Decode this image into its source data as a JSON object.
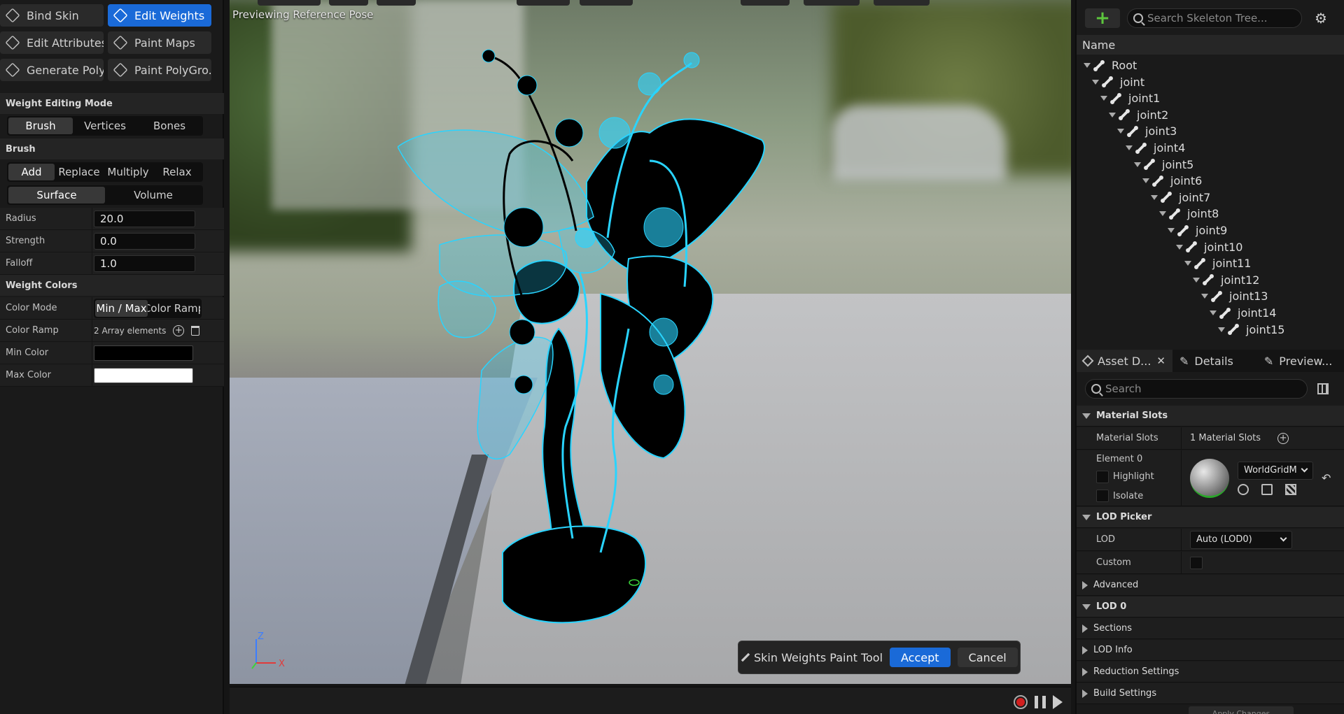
{
  "left": {
    "tools": [
      {
        "label": "Bind Skin",
        "active": false
      },
      {
        "label": "Edit Weights",
        "active": true
      },
      {
        "label": "Edit Attributes",
        "active": false
      },
      {
        "label": "Paint Maps",
        "active": false
      },
      {
        "label": "Generate Poly...",
        "active": false
      },
      {
        "label": "Paint PolyGro...",
        "active": false
      }
    ],
    "weight_editing_mode": {
      "header": "Weight Editing Mode",
      "options": [
        "Brush",
        "Vertices",
        "Bones"
      ],
      "selected": "Brush"
    },
    "brush": {
      "header": "Brush",
      "ops": [
        "Add",
        "Replace",
        "Multiply",
        "Relax"
      ],
      "op_selected": "Add",
      "space": [
        "Surface",
        "Volume"
      ],
      "space_selected": "Surface",
      "radius_label": "Radius",
      "radius": "20.0",
      "strength_label": "Strength",
      "strength": "0.0",
      "falloff_label": "Falloff",
      "falloff": "1.0"
    },
    "weight_colors": {
      "header": "Weight Colors",
      "color_mode_label": "Color Mode",
      "color_mode_options": [
        "Min / Max",
        "Color Ramp"
      ],
      "color_ramp_label": "Color Ramp",
      "color_ramp_value": "2 Array elements",
      "min_color_label": "Min Color",
      "min_color": "#000000",
      "max_color_label": "Max Color",
      "max_color": "#ffffff"
    }
  },
  "viewport": {
    "title": "Previewing Reference Pose",
    "wire_color": "#29d4ff",
    "axis_z": "Z",
    "axis_x": "X",
    "paint_tool": {
      "label": "Skin Weights Paint Tool",
      "accept": "Accept",
      "cancel": "Cancel"
    }
  },
  "skeleton": {
    "search_placeholder": "Search Skeleton Tree...",
    "header": "Name",
    "bones": [
      "Root",
      "joint",
      "joint1",
      "joint2",
      "joint3",
      "joint4",
      "joint5",
      "joint6",
      "joint7",
      "joint8",
      "joint9",
      "joint10",
      "joint11",
      "joint12",
      "joint13",
      "joint14",
      "joint15"
    ]
  },
  "details": {
    "tabs": [
      "Asset D...",
      "Details",
      "Preview..."
    ],
    "search_placeholder": "Search",
    "material_slots_header": "Material Slots",
    "material_slots_label": "Material Slots",
    "material_slots_value": "1 Material Slots",
    "element_label": "Element 0",
    "highlight_label": "Highlight",
    "isolate_label": "Isolate",
    "material_name": "WorldGridM",
    "lod_picker_header": "LOD Picker",
    "lod_label": "LOD",
    "lod_value": "Auto (LOD0)",
    "custom_label": "Custom",
    "advanced": "Advanced",
    "lod0_header": "LOD 0",
    "sections": "Sections",
    "lod_info": "LOD Info",
    "reduction_settings": "Reduction Settings",
    "build_settings": "Build Settings",
    "apply_changes": "Apply Changes"
  }
}
